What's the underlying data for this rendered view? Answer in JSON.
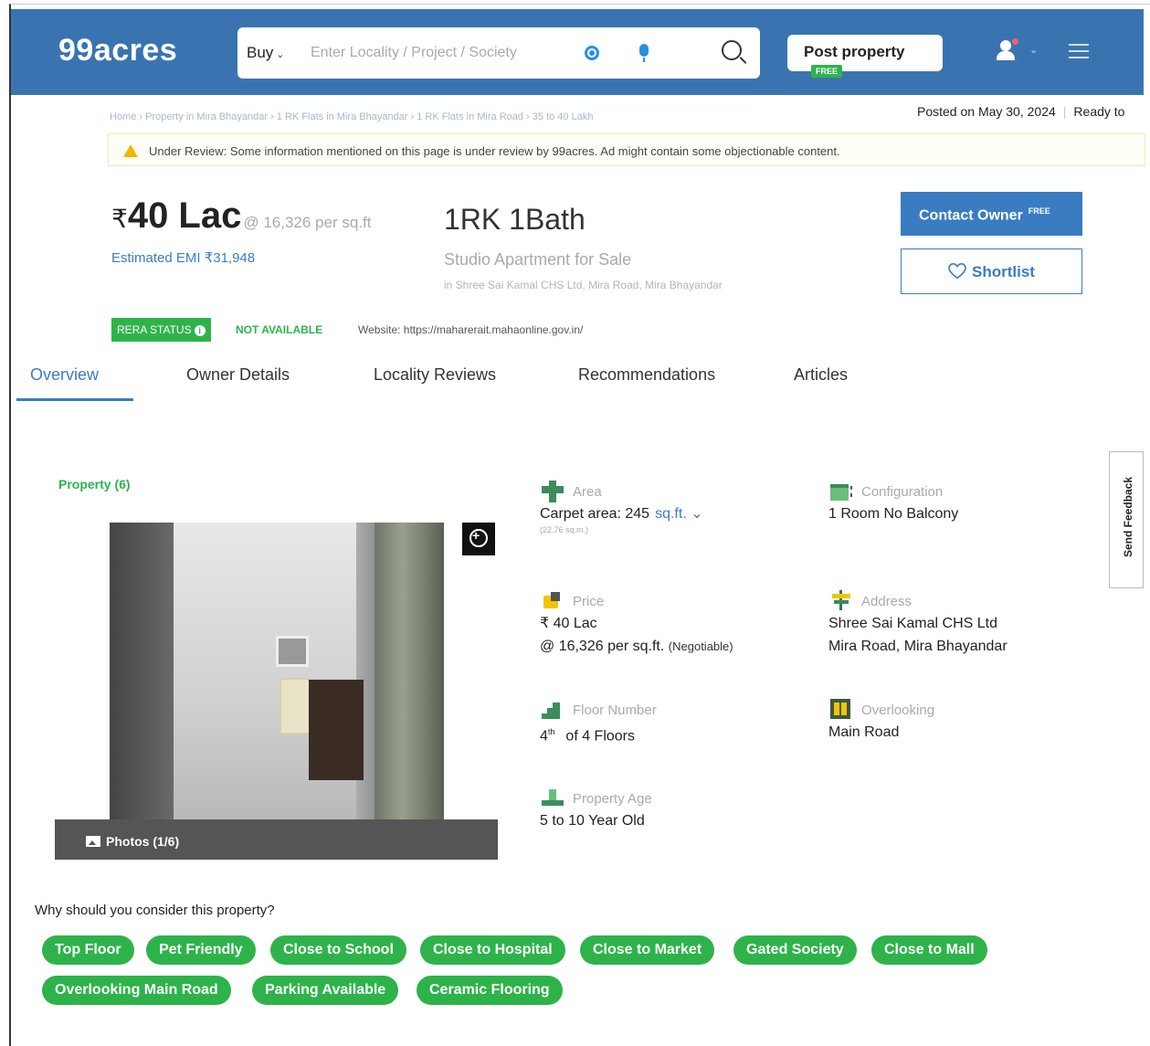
{
  "header": {
    "logo": "99acres",
    "search": {
      "mode": "Buy",
      "placeholder": "Enter Locality / Project / Society"
    },
    "post_property": {
      "label": "Post property",
      "badge": "FREE"
    }
  },
  "breadcrumb": "Home › Property in Mira Bhayandar › 1 RK Flats in Mira Bhayandar › 1 RK Flats in Mira Road › 35 to 40 Lakh",
  "posted": {
    "date": "Posted on May 30, 2024",
    "status": "Ready to"
  },
  "review_banner": {
    "title": "Under Review:",
    "text": "Some information mentioned on this page is under review by 99acres. Ad might contain some objectionable content."
  },
  "listing": {
    "rupee": "₹",
    "price": "40 Lac",
    "price_per_sqft": "@ 16,326 per sq.ft",
    "emi": "Estimated EMI ₹31,948",
    "configuration": "1RK 1Bath",
    "property_type": "Studio Apartment for Sale",
    "location": "in Shree Sai Kamal CHS Ltd, Mira Road, Mira Bhayandar"
  },
  "actions": {
    "contact": "Contact Owner",
    "contact_badge": "FREE",
    "shortlist": "Shortlist"
  },
  "rera": {
    "label": "RERA STATUS",
    "status": "NOT AVAILABLE",
    "website": "Website: https://maharerait.mahaonline.gov.in/"
  },
  "tabs": [
    "Overview",
    "Owner Details",
    "Locality Reviews",
    "Recommendations",
    "Articles"
  ],
  "gallery": {
    "count_label": "Property (6)",
    "photos_label": "Photos (1/6)"
  },
  "details": {
    "area": {
      "label": "Area",
      "value": "Carpet area: 245",
      "unit": "sq.ft.",
      "sub": "(22.76 sq.m.)"
    },
    "configuration": {
      "label": "Configuration",
      "value": "1 Room No Balcony"
    },
    "price": {
      "label": "Price",
      "value": "₹ 40 Lac",
      "per_sqft": "@ 16,326 per sq.ft.",
      "note": "(Negotiable)"
    },
    "address": {
      "label": "Address",
      "line1": "Shree Sai Kamal CHS Ltd",
      "line2": "Mira Road, Mira Bhayandar"
    },
    "floor": {
      "label": "Floor Number",
      "floor": "4",
      "suffix": "th",
      "total": "of 4 Floors"
    },
    "overlooking": {
      "label": "Overlooking",
      "value": "Main Road"
    },
    "age": {
      "label": "Property Age",
      "value": "5 to 10 Year Old"
    }
  },
  "feedback": "Send Feedback",
  "highlights": {
    "title": "Why should you consider this property?",
    "chips": [
      "Top Floor",
      "Pet Friendly",
      "Close to School",
      "Close to Hospital",
      "Close to Market",
      "Gated Society",
      "Close to Mall",
      "Overlooking Main Road",
      "Parking Available",
      "Ceramic Flooring"
    ]
  },
  "colors": {
    "brand": "#3a74b0",
    "accent_blue": "#3a7cc1",
    "green": "#2eb34a"
  }
}
